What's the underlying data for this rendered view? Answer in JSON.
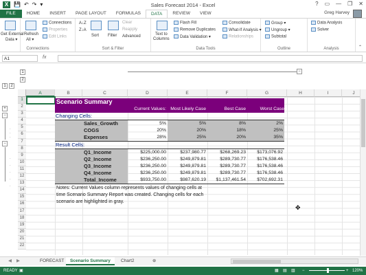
{
  "window": {
    "title": "Sales Forecast 2014 - Excel",
    "user": "Greg Harvey",
    "controls": [
      "?",
      "▭",
      "—",
      "❐",
      "✕"
    ]
  },
  "tabs": [
    "FILE",
    "HOME",
    "INSERT",
    "PAGE LAYOUT",
    "FORMULAS",
    "DATA",
    "REVIEW",
    "VIEW"
  ],
  "active_tab": "DATA",
  "ribbon": {
    "get_external": {
      "line1": "Get External",
      "line2": "Data ▾"
    },
    "refresh": {
      "line1": "Refresh",
      "line2": "All ▾"
    },
    "connections": [
      "Connections",
      "Properties",
      "Edit Links"
    ],
    "connections_label": "Connections",
    "sort_az": "A↓Z",
    "sort_za": "Z↓A",
    "sort": "Sort",
    "filter": "Filter",
    "clear": "Clear",
    "reapply": "Reapply",
    "advanced": "Advanced",
    "sortfilter_label": "Sort & Filter",
    "text_to_columns": {
      "line1": "Text to",
      "line2": "Columns"
    },
    "flash_fill": "Flash Fill",
    "remove_duplicates": "Remove Duplicates",
    "data_validation": "Data Validation ▾",
    "consolidate": "Consolidate",
    "whatif": "What-If Analysis ▾",
    "relationships": "Relationships",
    "datatools_label": "Data Tools",
    "group": "Group ▾",
    "ungroup": "Ungroup ▾",
    "subtotal": "Subtotal",
    "outline_label": "Outline",
    "data_analysis": "Data Analysis",
    "solver": "Solver",
    "analysis_label": "Analysis"
  },
  "namebox": "A1",
  "fx": "fx",
  "outline_levels": [
    "1",
    "2"
  ],
  "columns": [
    "A",
    "B",
    "C",
    "D",
    "E",
    "F",
    "G",
    "H",
    "I",
    "J"
  ],
  "rows": [
    "1",
    "2",
    "3",
    "4",
    "5",
    "6",
    "7",
    "8",
    "9",
    "10",
    "11",
    "12",
    "13",
    "14",
    "15",
    "16",
    "17",
    "18",
    "19",
    "20",
    "21",
    "22"
  ],
  "report": {
    "title": "Scenario Summary",
    "headers": [
      "Current Values:",
      "Most Likely Case",
      "Best Case",
      "Worst Case"
    ],
    "changing_label": "Changing Cells:",
    "changing": [
      {
        "name": "Sales_Growth",
        "values": [
          "5%",
          "5%",
          "8%",
          "2%"
        ]
      },
      {
        "name": "COGS",
        "values": [
          "20%",
          "20%",
          "18%",
          "25%"
        ]
      },
      {
        "name": "Expenses",
        "values": [
          "28%",
          "25%",
          "20%",
          "35%"
        ]
      }
    ],
    "result_label": "Result Cells:",
    "results": [
      {
        "name": "Q1_Income",
        "values": [
          "$225,000.00",
          "$237,980.77",
          "$268,269.23",
          "$173,076.92"
        ]
      },
      {
        "name": "Q2_Income",
        "values": [
          "$236,250.00",
          "$249,879.81",
          "$289,730.77",
          "$176,538.46"
        ]
      },
      {
        "name": "Q3_Income",
        "values": [
          "$236,250.00",
          "$249,879.81",
          "$289,730.77",
          "$176,538.46"
        ]
      },
      {
        "name": "Q4_Income",
        "values": [
          "$236,250.00",
          "$249,879.81",
          "$289,730.77",
          "$176,538.46"
        ]
      },
      {
        "name": "Total_Income",
        "values": [
          "$933,750.00",
          "$987,620.19",
          "$1,137,461.54",
          "$702,692.31"
        ]
      }
    ],
    "notes": [
      "Notes:  Current Values column represents values of changing cells at",
      "time Scenario Summary Report was created.  Changing cells for each",
      "scenario are highlighted in gray."
    ]
  },
  "sheet_tabs": [
    "FORECAST",
    "Scenario Summary",
    "Chart2"
  ],
  "active_sheet": "Scenario Summary",
  "status": {
    "ready": "READY",
    "zoom": "120%"
  },
  "colors": {
    "accent": "#217346",
    "header_fill": "#7b007b",
    "gray_fill": "#c0c0c0"
  }
}
